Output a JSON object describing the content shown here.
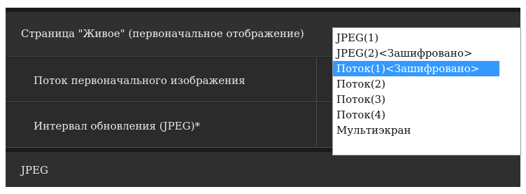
{
  "section": {
    "title": "Страница \"Живое\" (первоначальное отображение)"
  },
  "rows": [
    {
      "label": "Поток первоначального изображения"
    },
    {
      "label": "Интервал обновления (JPEG)*"
    }
  ],
  "subsection": {
    "title": "JPEG"
  },
  "dropdown": {
    "options": [
      "JPEG(1)",
      "JPEG(2)<Зашифровано>",
      "Поток(1)<Зашифровано>",
      "Поток(2)",
      "Поток(3)",
      "Поток(4)",
      "Мультиэкран"
    ],
    "selected_index": 2
  },
  "colors": {
    "panel_bg": "#1b1b1b",
    "header_bg": "#303030",
    "row_bg": "#2b2b2b",
    "highlight": "#3399ff"
  }
}
